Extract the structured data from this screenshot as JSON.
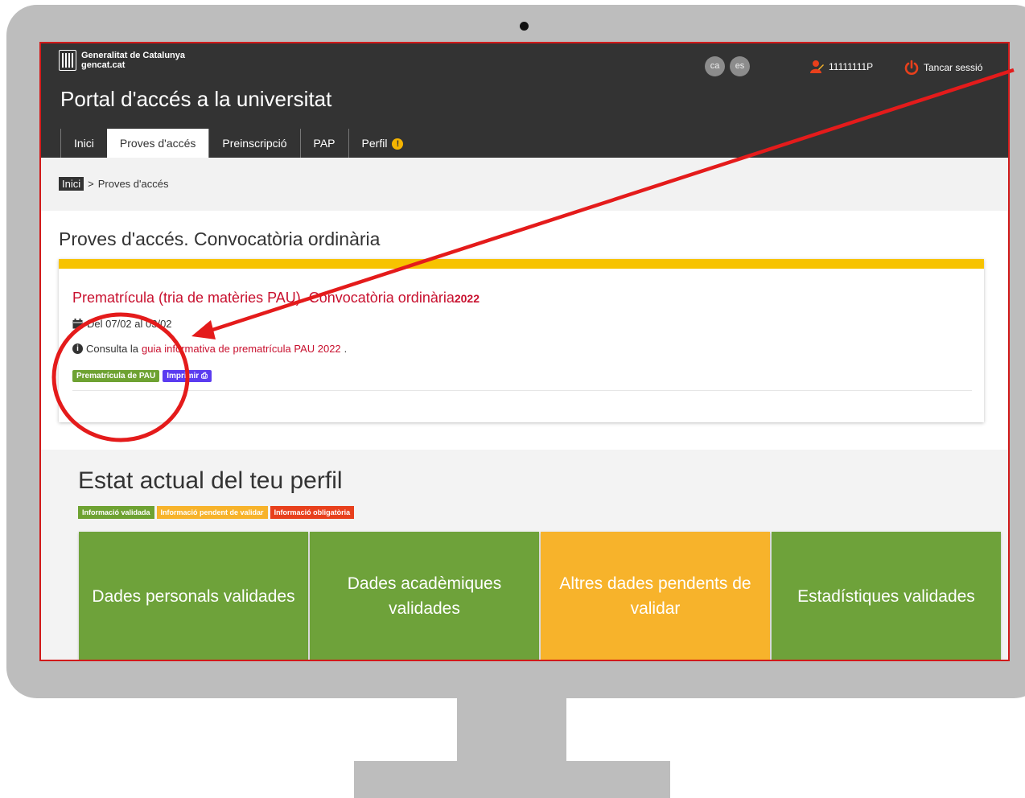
{
  "header": {
    "brand_line1": "Generalitat de Catalunya",
    "brand_line2": "gencat.cat",
    "portal_title": "Portal d'accés a la universitat",
    "lang_ca": "ca",
    "lang_es": "es",
    "user_id": "11111111P",
    "logout": "Tancar sessió"
  },
  "tabs": [
    {
      "label": "Inici"
    },
    {
      "label": "Proves d'accés"
    },
    {
      "label": "Preinscripció"
    },
    {
      "label": "PAP"
    },
    {
      "label": "Perfil"
    }
  ],
  "breadcrumb": {
    "home": "Inici",
    "separator": ">",
    "current": "Proves d'accés"
  },
  "section_title": "Proves d'accés. Convocatòria ordinària",
  "card": {
    "title": "Prematrícula (tria de matèries PAU). Convocatòria ordinària",
    "year": "2022",
    "dates": "Del 07/02 al 03/02",
    "info_prefix": "Consulta la",
    "info_link": "guia informativa de prematrícula PAU 2022",
    "info_suffix": ".",
    "btn_prematricula": "Prematrícula de PAU",
    "btn_print": "Imprimir"
  },
  "profile": {
    "title": "Estat actual del teu perfil",
    "legend": [
      "Informació validada",
      "Informació pendent de validar",
      "Informació obligatòria"
    ],
    "tiles": [
      {
        "label": "Dades personals validades",
        "color": "#6ea23a"
      },
      {
        "label": "Dades acadèmiques validades",
        "color": "#6ea23a"
      },
      {
        "label": "Altres dades pendents de validar",
        "color": "#f7b32b"
      },
      {
        "label": "Estadístiques validades",
        "color": "#6ea23a"
      }
    ]
  },
  "colors": {
    "accent_red": "#c8102e",
    "header_bg": "#333333",
    "card_top": "#f7c300",
    "legend_green": "#6ea232",
    "legend_orange": "#f7b32b",
    "legend_red": "#e8401c"
  }
}
